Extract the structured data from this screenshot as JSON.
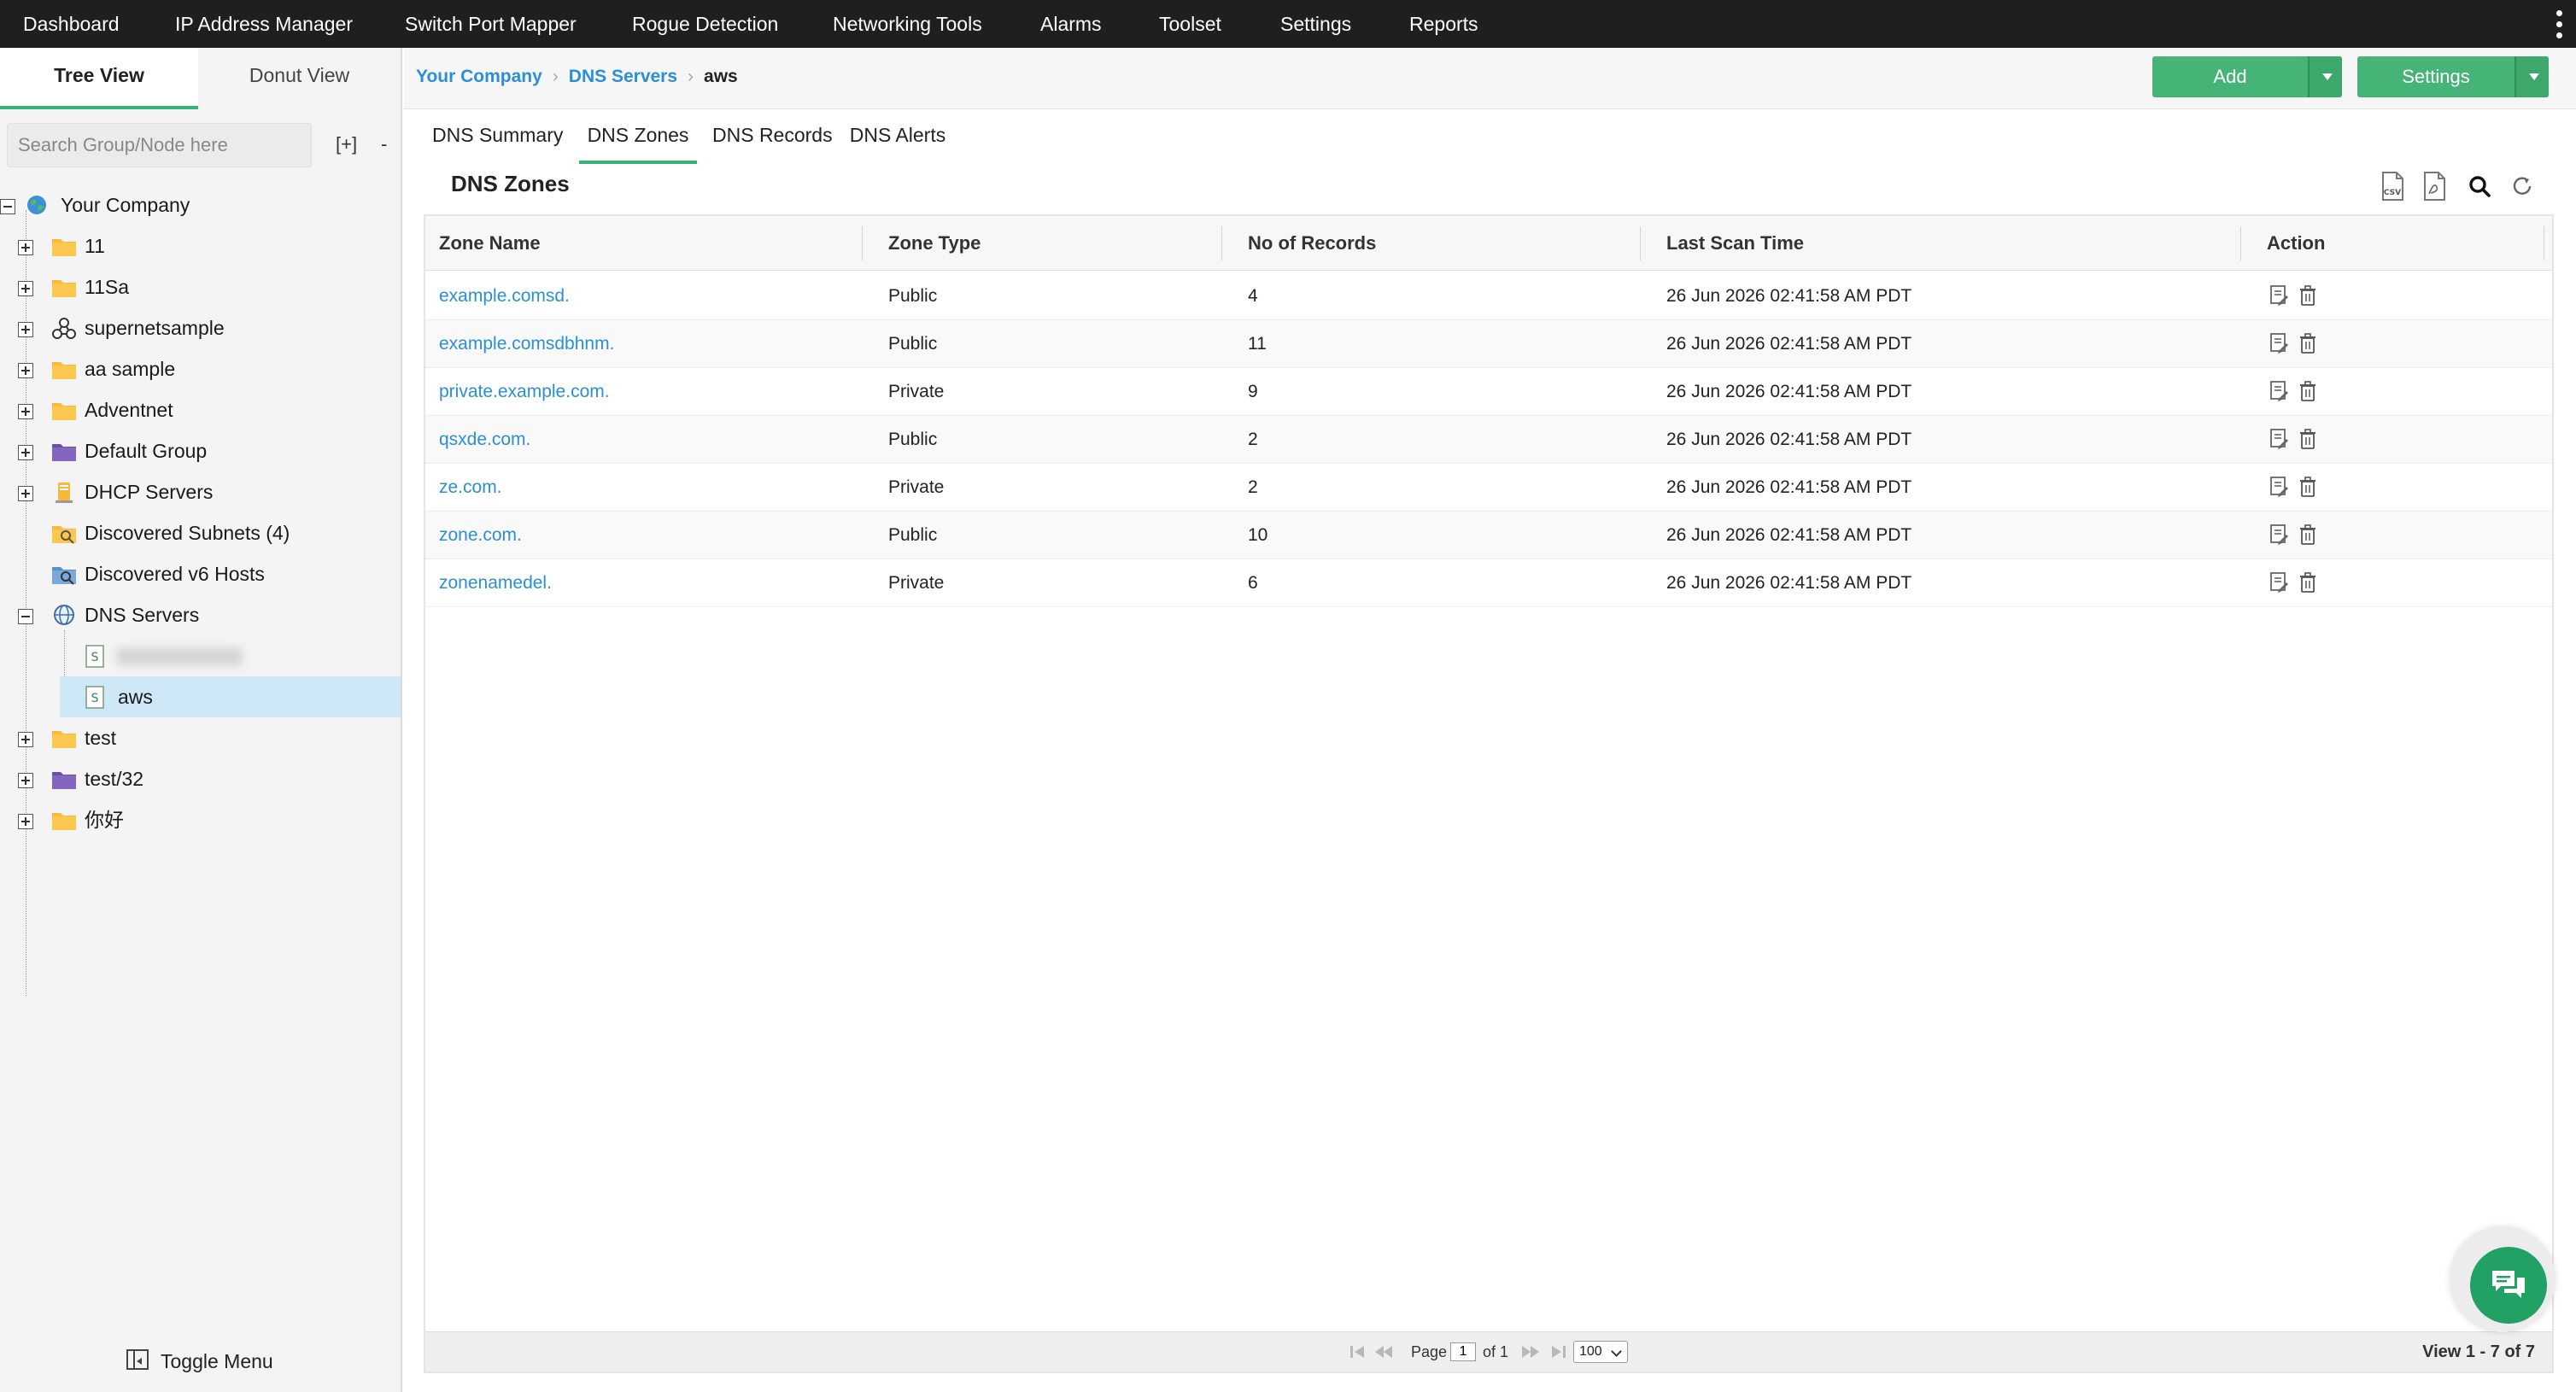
{
  "topnav": {
    "items": [
      "Dashboard",
      "IP Address Manager",
      "Switch Port Mapper",
      "Rogue Detection",
      "Networking Tools",
      "Alarms",
      "Toolset",
      "Settings",
      "Reports"
    ]
  },
  "sidebar": {
    "tabs": [
      "Tree View",
      "Donut View"
    ],
    "search_placeholder": "Search Group/Node here",
    "expand_all": "[+]",
    "collapse_all": "-",
    "tree": [
      {
        "label": "Your Company",
        "icon": "globe-icon"
      },
      {
        "label": "11",
        "icon": "folder-icon"
      },
      {
        "label": "11Sa",
        "icon": "folder-icon"
      },
      {
        "label": "supernetsample",
        "icon": "supernet-icon"
      },
      {
        "label": "aa sample",
        "icon": "folder-icon"
      },
      {
        "label": "Adventnet",
        "icon": "folder-icon"
      },
      {
        "label": "Default Group",
        "icon": "purple-folder-icon"
      },
      {
        "label": "DHCP Servers",
        "icon": "dhcp-server-icon"
      },
      {
        "label": "Discovered Subnets (4)",
        "icon": "search-folder-icon"
      },
      {
        "label": "Discovered v6 Hosts",
        "icon": "search-folder-icon"
      },
      {
        "label": "DNS Servers",
        "icon": "globe-grid-icon"
      },
      {
        "label": "",
        "icon": "server-file-icon"
      },
      {
        "label": "aws",
        "icon": "server-file-icon"
      },
      {
        "label": "test",
        "icon": "folder-icon"
      },
      {
        "label": "test/32",
        "icon": "purple-folder-icon"
      },
      {
        "label": "你好",
        "icon": "folder-icon"
      }
    ],
    "toggle_menu": "Toggle Menu"
  },
  "breadcrumb": {
    "items": [
      "Your Company",
      "DNS Servers"
    ],
    "current": "aws"
  },
  "buttons": {
    "add": "Add",
    "settings": "Settings"
  },
  "tabs": [
    "DNS Summary",
    "DNS Zones",
    "DNS Records",
    "DNS Alerts"
  ],
  "section_title": "DNS Zones",
  "grid": {
    "columns": [
      "Zone Name",
      "Zone Type",
      "No of Records",
      "Last Scan Time",
      "Action"
    ],
    "rows": [
      {
        "zone": "example.comsd.",
        "type": "Public",
        "records": "4",
        "scan": "26 Jun 2026 02:41:58 AM PDT"
      },
      {
        "zone": "example.comsdbhnm.",
        "type": "Public",
        "records": "11",
        "scan": "26 Jun 2026 02:41:58 AM PDT"
      },
      {
        "zone": "private.example.com.",
        "type": "Private",
        "records": "9",
        "scan": "26 Jun 2026 02:41:58 AM PDT"
      },
      {
        "zone": "qsxde.com.",
        "type": "Public",
        "records": "2",
        "scan": "26 Jun 2026 02:41:58 AM PDT"
      },
      {
        "zone": "ze.com.",
        "type": "Private",
        "records": "2",
        "scan": "26 Jun 2026 02:41:58 AM PDT"
      },
      {
        "zone": "zone.com.",
        "type": "Public",
        "records": "10",
        "scan": "26 Jun 2026 02:41:58 AM PDT"
      },
      {
        "zone": "zonenamedel.",
        "type": "Private",
        "records": "6",
        "scan": "26 Jun 2026 02:41:58 AM PDT"
      }
    ]
  },
  "pager": {
    "page_label": "Page",
    "page_value": "1",
    "of_label": "of 1",
    "page_size": "100",
    "view_count": "View 1 - 7 of 7"
  },
  "colors": {
    "accent_green": "#47b477",
    "link_blue": "#2a8fd6",
    "topbar": "#1f1f1f",
    "selected_row": "#cfe8f7"
  }
}
